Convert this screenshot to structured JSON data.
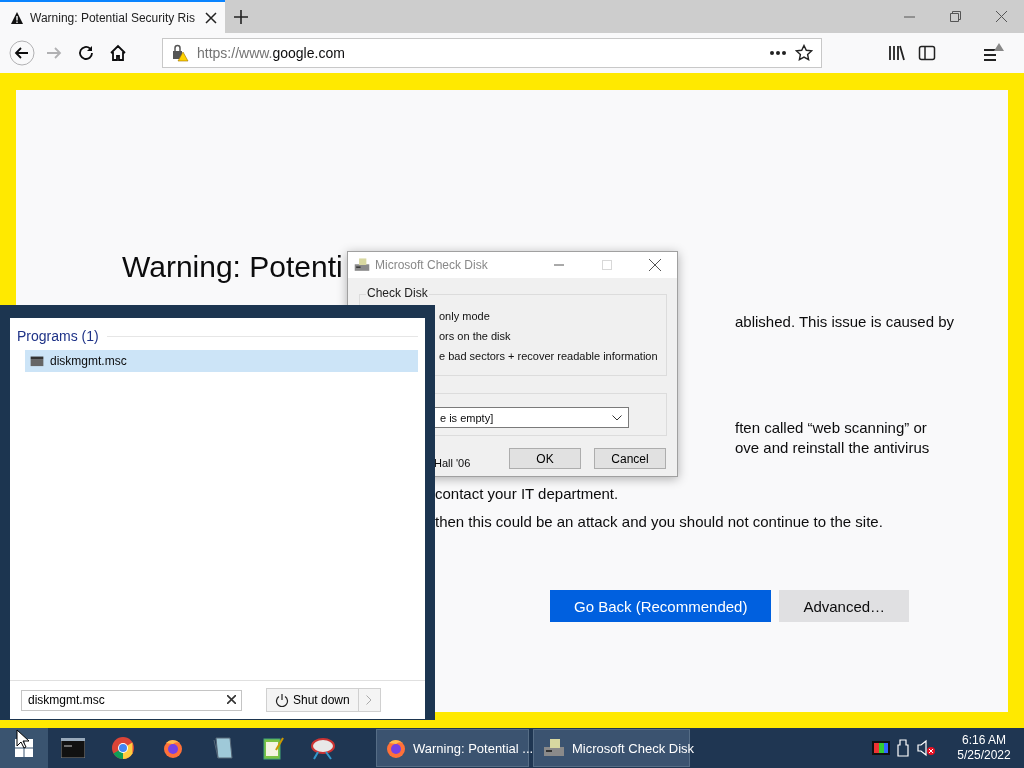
{
  "browser": {
    "tab": {
      "title": "Warning: Potential Security Ris",
      "selected": true
    },
    "nav": [
      {
        "kind": "back",
        "disabled": false
      },
      {
        "kind": "forward",
        "disabled": true
      },
      {
        "kind": "reload",
        "disabled": false
      },
      {
        "kind": "home",
        "disabled": false
      }
    ],
    "url": {
      "scheme": "https://www.",
      "domain": "google.com"
    }
  },
  "page": {
    "heading": "Warning: Potenti",
    "fragments_right": [
      "ablished. This issue is caused by",
      "ften called “web scanning” or",
      "ove and reinstall the antivirus"
    ],
    "fragments_left": [
      "contact your IT department.",
      "then this could be an attack and you should not continue to the site."
    ],
    "buttons": [
      {
        "label": "Go Back (Recommended)",
        "kind": "primary"
      },
      {
        "label": "Advanced…",
        "kind": "secondary"
      }
    ]
  },
  "dialog": {
    "title": "Microsoft Check Disk",
    "maximize_disabled": true,
    "group_title": "Check Disk",
    "options": [
      "only mode",
      "ors on the disk",
      "e bad sectors + recover readable information"
    ],
    "combo_value": "e is empty]",
    "note": "Hall '06",
    "buttons": [
      "OK",
      "Cancel"
    ]
  },
  "start_menu": {
    "section": "Programs (1)",
    "results": [
      {
        "label": "diskmgmt.msc",
        "selected": true
      }
    ],
    "search_value": "diskmgmt.msc",
    "shutdown_label": "Shut down"
  },
  "taskbar": {
    "tasks": [
      {
        "label": "Warning: Potential ...",
        "kind": "browser"
      },
      {
        "label": "Microsoft Check Disk",
        "kind": "disk"
      }
    ],
    "clock": {
      "time": "6:16 AM",
      "date": "5/25/2022"
    }
  }
}
